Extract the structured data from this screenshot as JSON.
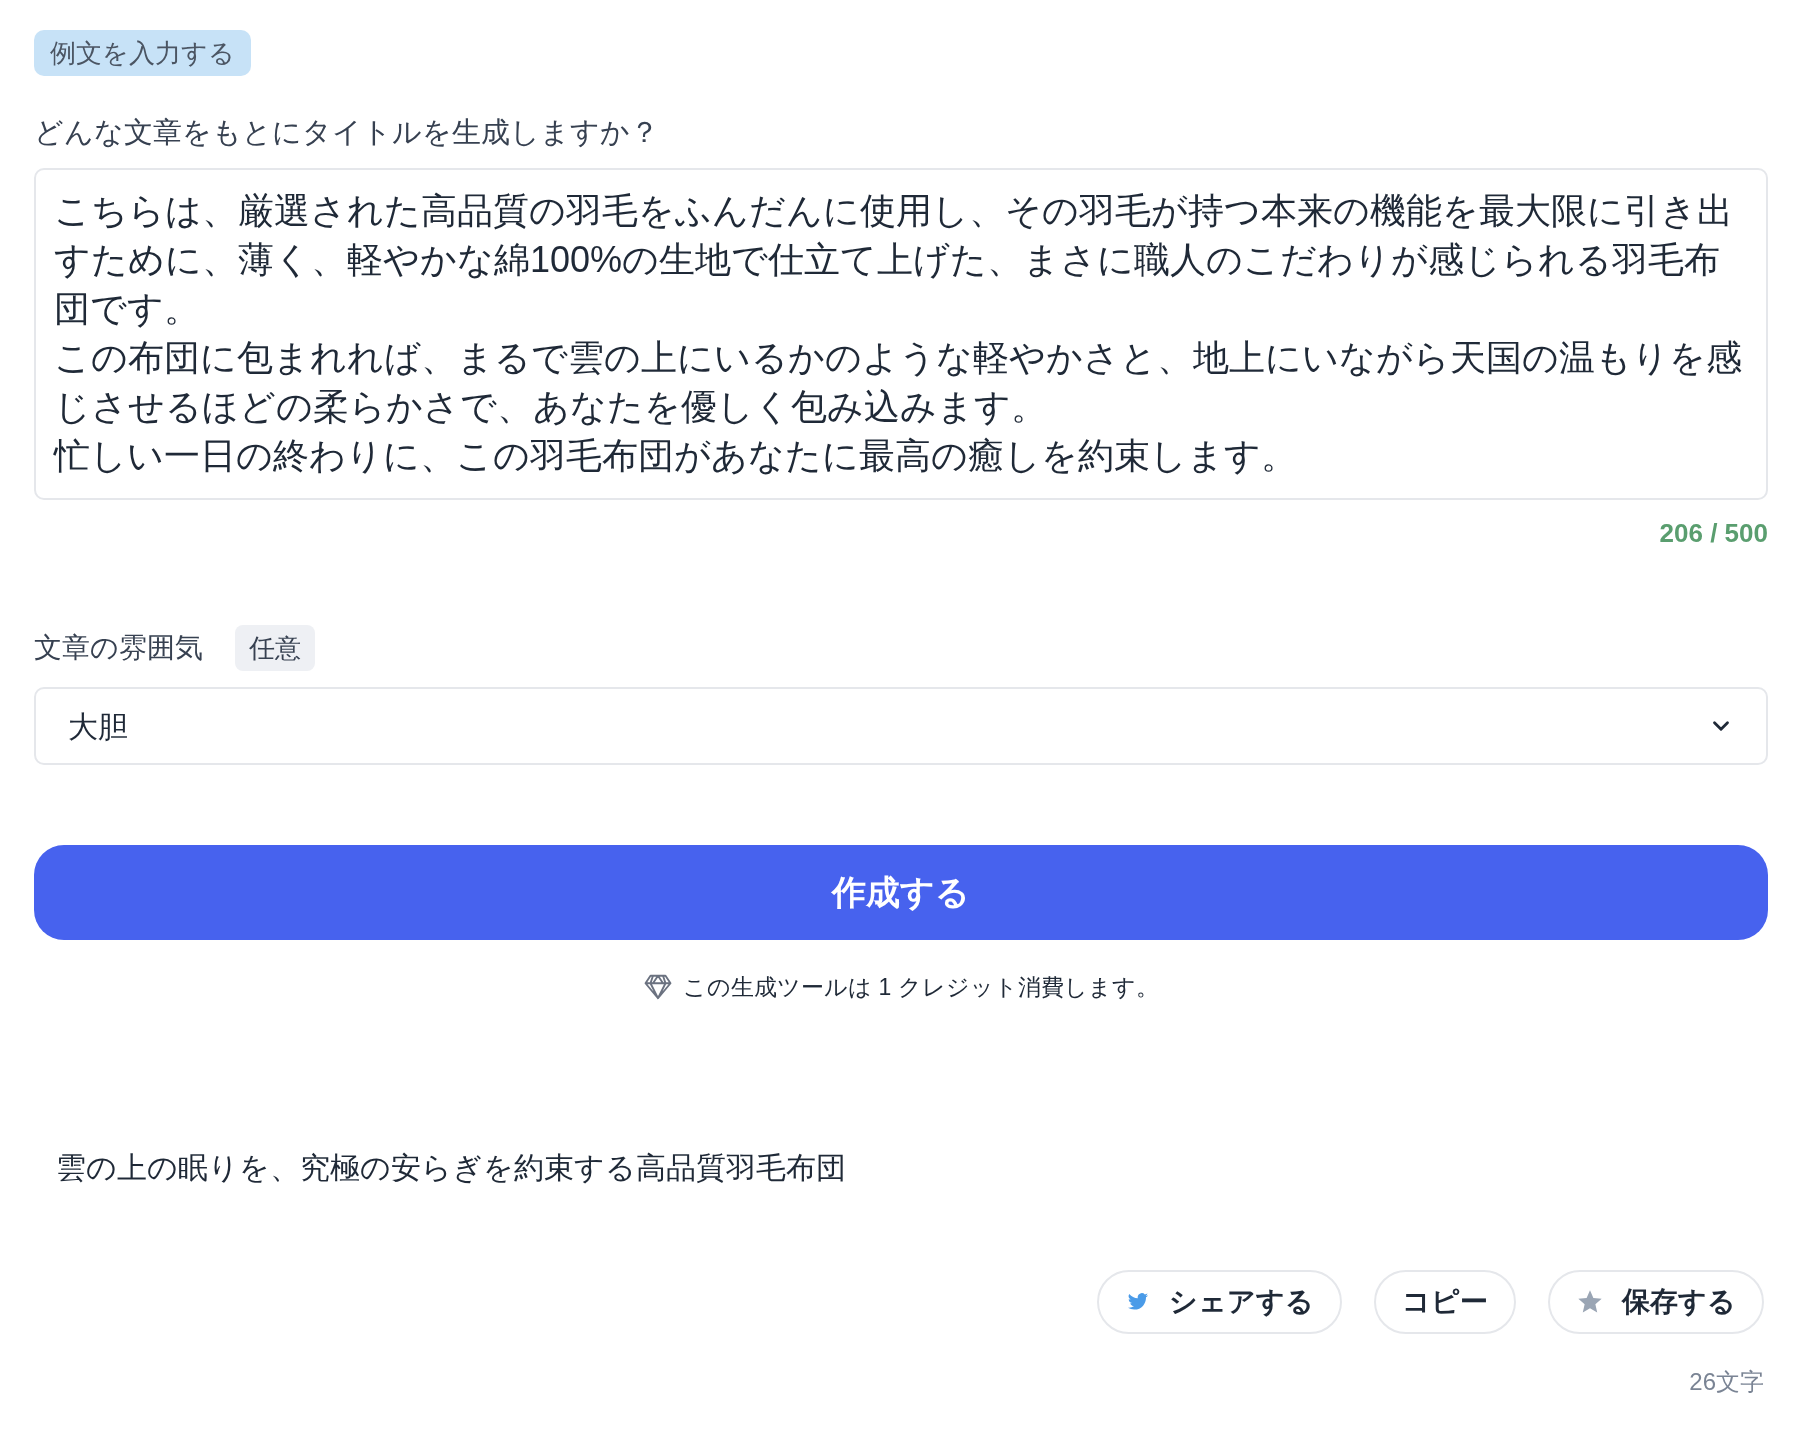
{
  "example_button": "例文を入力する",
  "prompt_label": "どんな文章をもとにタイトルを生成しますか？",
  "source_paragraphs": [
    "こちらは、厳選された高品質の羽毛をふんだんに使用し、その羽毛が持つ本来の機能を最大限に引き出すために、薄く、軽やかな綿100%の生地で仕立て上げた、まさに職人のこだわりが感じられる羽毛布団です。",
    "この布団に包まれれば、まるで雲の上にいるかのような軽やかさと、地上にいながら天国の温もりを感じさせるほどの柔らかさで、あなたを優しく包み込みます。",
    "忙しい一日の終わりに、この羽毛布団があなたに最高の癒しを約束します。"
  ],
  "char_count": "206 / 500",
  "tone": {
    "label": "文章の雰囲気",
    "badge": "任意",
    "value": "大胆"
  },
  "submit_button": "作成する",
  "credit_note": "この生成ツールは 1 クレジット消費します。",
  "result": {
    "text": "雲の上の眠りを、究極の安らぎを約束する高品質羽毛布団",
    "actions": [
      {
        "kind": "share",
        "label": "シェアする"
      },
      {
        "kind": "copy",
        "label": "コピー"
      },
      {
        "kind": "save",
        "label": "保存する"
      }
    ],
    "char_count": "26文字"
  }
}
